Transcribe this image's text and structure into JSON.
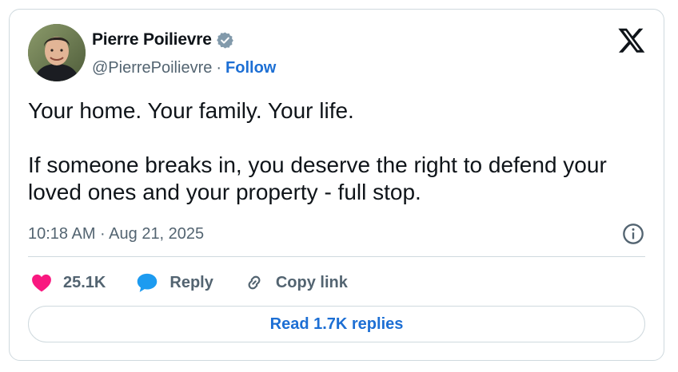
{
  "author": {
    "display_name": "Pierre Poilievre",
    "handle": "@PierrePoilievre",
    "separator": "·",
    "follow_label": "Follow"
  },
  "tweet": {
    "text": "Your home. Your family. Your life.\n\nIf someone breaks in, you deserve the right to defend your loved ones and your property - full stop.",
    "timestamp": "10:18 AM · Aug 21, 2025"
  },
  "actions": {
    "likes_count": "25.1K",
    "reply_label": "Reply",
    "copy_link_label": "Copy link"
  },
  "replies_button_label": "Read 1.7K replies",
  "icons": {
    "verified": "verified-badge-icon",
    "brand": "x-logo-icon",
    "info": "info-icon",
    "like": "heart-icon",
    "reply": "reply-bubble-icon",
    "copy_link": "link-icon"
  },
  "colors": {
    "link_blue": "#1d6fd4",
    "heart_pink": "#f91880",
    "reply_blue": "#1d9bf0",
    "muted_text": "#536471",
    "border": "#cfd9de"
  }
}
